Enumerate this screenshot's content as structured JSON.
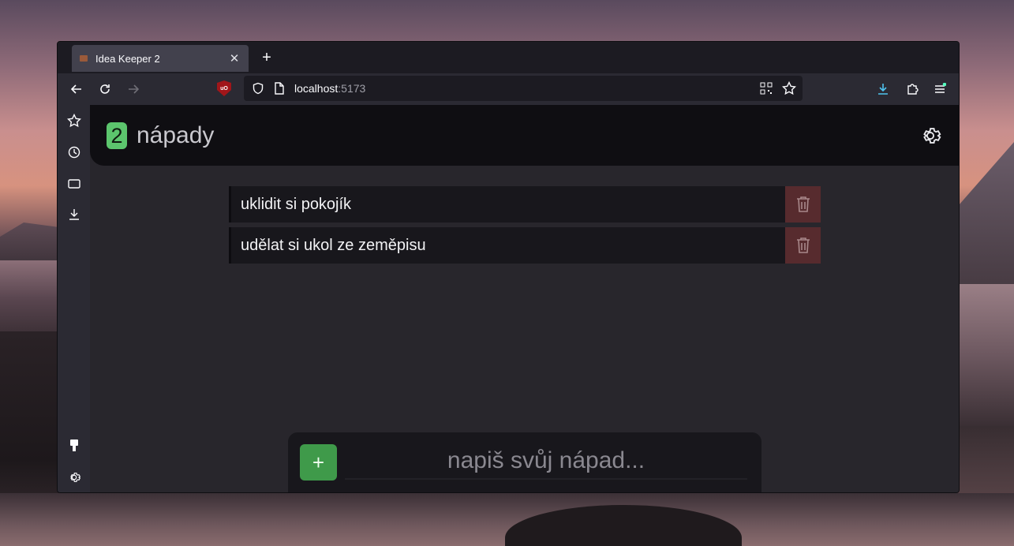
{
  "browser": {
    "tab": {
      "title": "Idea Keeper 2",
      "close_label": "✕"
    },
    "new_tab_label": "+",
    "url": {
      "host": "localhost",
      "port": ":5173"
    },
    "ublock_label": "uO"
  },
  "app": {
    "count": "2",
    "title": "nápady",
    "ideas": [
      {
        "text": "uklidit si pokojík"
      },
      {
        "text": "udělat si ukol ze zeměpisu"
      }
    ],
    "add_label": "+",
    "input": {
      "placeholder": "napiš svůj nápad...",
      "value": ""
    }
  },
  "colors": {
    "accent_green": "#5cc56d",
    "add_button": "#3f9a4a",
    "delete_button": "#572b2e",
    "header_bg": "#0f0e12",
    "app_bg": "#28262c"
  }
}
